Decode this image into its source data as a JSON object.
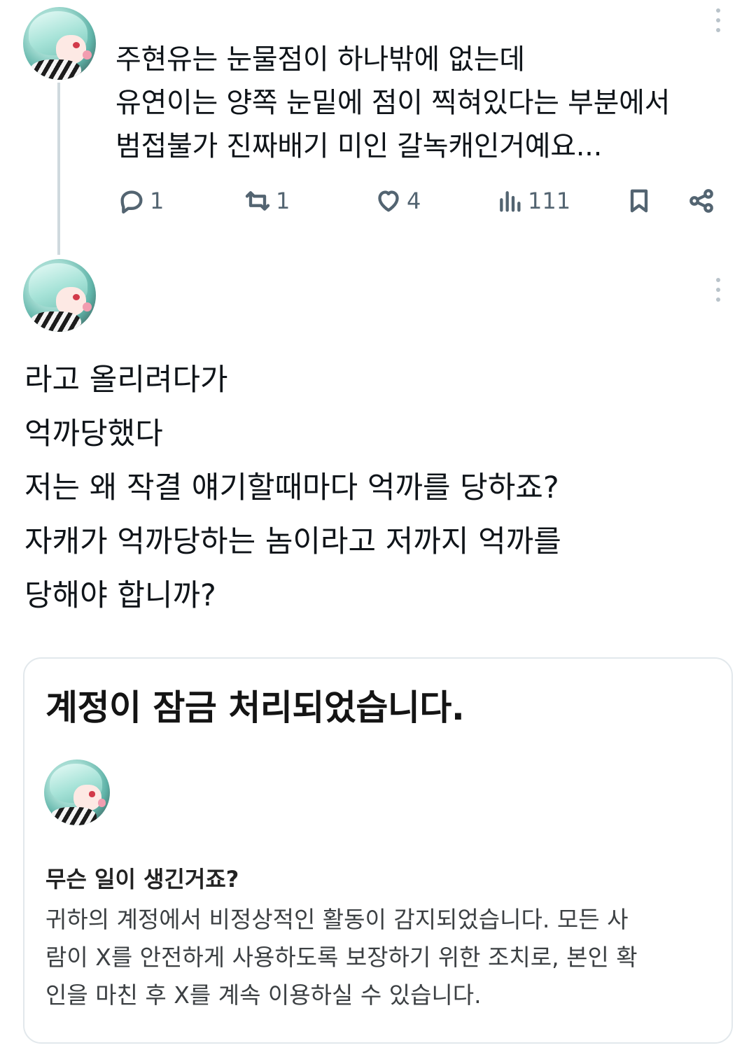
{
  "tweet1": {
    "text_lines": [
      "주현유는 눈물점이 하나밖에 없는데",
      "유연이는 양쪽 눈밑에 점이 찍혀있다는 부분에서",
      "범접불가 진짜배기 미인 갈녹캐인거예요..."
    ],
    "actions": {
      "reply_count": "1",
      "repost_count": "1",
      "like_count": "4",
      "views_count": "111"
    }
  },
  "tweet2": {
    "text_lines": [
      "라고 올리려다가",
      "억까당했다",
      "저는 왜 작결 얘기할때마다 억까를 당하죠?",
      "자캐가 억까당하는 놈이라고 저까지 억까를",
      "당해야 합니까?"
    ]
  },
  "locked_card": {
    "title": "계정이 잠금 처리되었습니다.",
    "subtitle": "무슨 일이 생긴거죠?",
    "body_lines": [
      "귀하의 계정에서 비정상적인 활동이 감지되었습니다. 모든 사",
      "람이 X를 안전하게 사용하도록 보장하기 위한 조치로, 본인 확",
      "인을 마친 후 X를 계속 이용하실 수 있습니다."
    ]
  },
  "icons": [
    "avatar",
    "more-icon",
    "reply-icon",
    "repost-icon",
    "like-icon",
    "views-icon",
    "bookmark-icon",
    "share-icon"
  ],
  "colors": {
    "text": "#0f1419",
    "secondary": "#536471",
    "thread_line": "#cfd9de",
    "card_border": "#e2e8ec"
  }
}
